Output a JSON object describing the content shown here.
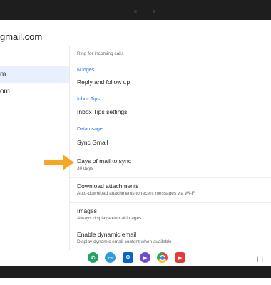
{
  "account_title": "gmail.com",
  "left_nav": [
    {
      "label": "m"
    },
    {
      "label": "om"
    }
  ],
  "settings": {
    "top_sub": "Ring for incoming calls",
    "nudges_header": "Nudges",
    "reply_follow_up": "Reply and follow up",
    "inbox_tips_header": "Inbox Tips",
    "inbox_tips_settings": "Inbox Tips settings",
    "data_usage_header": "Data usage",
    "sync_gmail": "Sync Gmail",
    "days_to_sync_title": "Days of mail to sync",
    "days_to_sync_value": "30 days",
    "download_attachments_title": "Download attachments",
    "download_attachments_sub": "Auto-download attachments to recent messages via Wi-Fi",
    "images_title": "Images",
    "images_sub": "Always display external images",
    "dynamic_email_title": "Enable dynamic email",
    "dynamic_email_sub": "Display dynamic email content when available"
  },
  "dock_apps": [
    "phone-icon",
    "messages-icon",
    "outlook-icon",
    "tv-icon",
    "chrome-icon",
    "youtube-icon"
  ],
  "colors": {
    "accent": "#1a73e8",
    "arrow": "#f5a623",
    "selected_bg": "#e8f0fe"
  }
}
